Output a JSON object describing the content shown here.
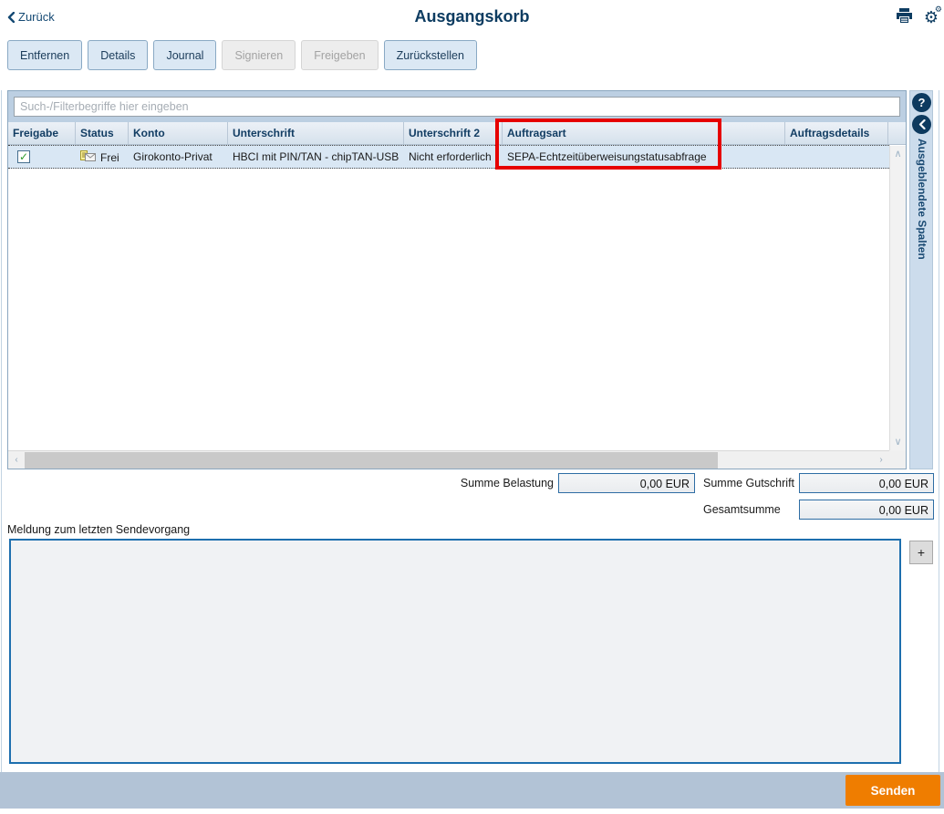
{
  "header": {
    "back_label": "Zurück",
    "title": "Ausgangskorb"
  },
  "toolbar": {
    "buttons": [
      {
        "label": "Entfernen",
        "enabled": true
      },
      {
        "label": "Details",
        "enabled": true
      },
      {
        "label": "Journal",
        "enabled": true
      },
      {
        "label": "Signieren",
        "enabled": false
      },
      {
        "label": "Freigeben",
        "enabled": false
      },
      {
        "label": "Zurückstellen",
        "enabled": true
      }
    ]
  },
  "search": {
    "placeholder": "Such-/Filterbegriffe hier eingeben"
  },
  "table": {
    "columns": [
      "Freigabe",
      "Status",
      "Konto",
      "Unterschrift",
      "Unterschrift 2",
      "Auftragsart",
      "Auftragsdetails"
    ],
    "rows": [
      {
        "freigabe_checked": true,
        "check_glyph": "✓",
        "status": "Frei",
        "konto": "Girokonto-Privat",
        "unterschrift": "HBCI mit PIN/TAN - chipTAN-USB",
        "unterschrift2": "Nicht erforderlich",
        "auftragsart": "SEPA-Echtzeitüberweisungstatusabfrage",
        "auftragsdetails": ""
      }
    ]
  },
  "side_panel": {
    "help_glyph": "?",
    "hidden_columns_label": "Ausgeblendete Spalten"
  },
  "scrollbar": {
    "up_glyph": "∧",
    "down_glyph": "∨",
    "left_glyph": "‹",
    "right_glyph": "›"
  },
  "totals": {
    "belastung_label": "Summe Belastung",
    "belastung_value": "0,00 EUR",
    "gutschrift_label": "Summe Gutschrift",
    "gutschrift_value": "0,00 EUR",
    "gesamt_label": "Gesamtsumme",
    "gesamt_value": "0,00 EUR"
  },
  "message": {
    "label": "Meldung zum letzten Sendevorgang",
    "value": "",
    "add_button_label": "+"
  },
  "footer": {
    "send_label": "Senden"
  },
  "colors": {
    "navy": "#0d3c61",
    "accent_orange": "#ef7d00",
    "highlight_red": "#e60000",
    "selected_row": "#d9e7f4",
    "bottom_bar": "#b2c3d6"
  }
}
